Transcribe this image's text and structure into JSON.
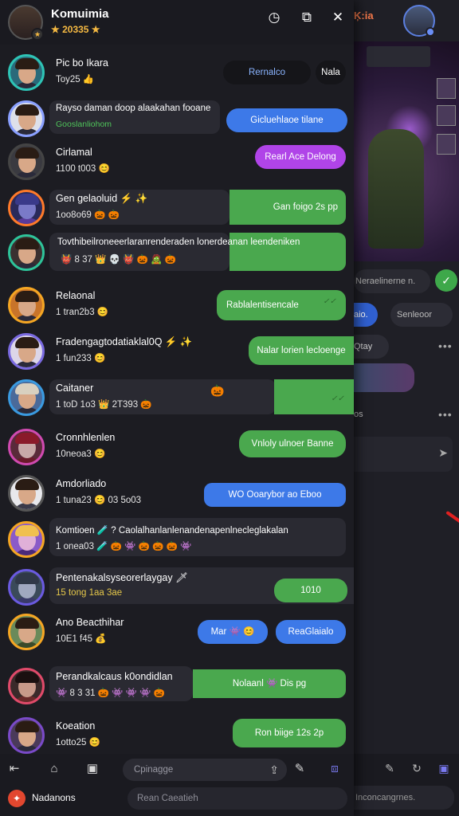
{
  "background": {
    "title": "Ķ:ia",
    "input_placeholder": "Neraelinerne n.",
    "chip_active": "aio.",
    "chip_secondary": "Senleoor",
    "chip_third": "Qtay",
    "chip_fourth": "os",
    "bottom_search": "Inconcangrnes."
  },
  "header": {
    "title": "Komuimia",
    "subtitle": "★ 20335 ★"
  },
  "rows": [
    {
      "name": "Pic bo Ikara",
      "status": "Toy25 👍",
      "bubbles": [
        "Rernalco",
        "Nala"
      ]
    },
    {
      "name": "Rayso daman doop alaakahan fooane",
      "status": "Gooslanliohom",
      "bubbles": [
        "Gicluehlaoe tilane"
      ]
    },
    {
      "name": "Cirlamal",
      "status": "1100 t003 😊",
      "bubbles": [
        "Rearl Ace Delong"
      ]
    },
    {
      "name": "Gen gelaoluid ⚡ ✨",
      "status": "1oo8o69 🎃 🎃",
      "bubbles": [
        "Gan foigo 2s pp"
      ]
    },
    {
      "name": "Tovthibeilroneeerlaranrenderaden lonerdeanan leendeniken",
      "status": "👹 8 37 👑 💀 👹 🎃 🧟 🎃",
      "bubbles": []
    },
    {
      "name": "Relaonal",
      "status": "1 tran2b3 😊",
      "bubbles": [
        "Rablalentisencale"
      ]
    },
    {
      "name": "Fradengagtodatiaklal0Q ⚡ ✨",
      "status": "1 fun233 😊",
      "bubbles": [
        "Nalar lorien lecloenge"
      ]
    },
    {
      "name": "Caitaner",
      "status": "1 toD 1o3 👑 2T393 🎃",
      "bubbles": []
    },
    {
      "name": "Cronnhlenlen",
      "status": "10neoa3 😊",
      "bubbles": [
        "Vnloly ulnoer Banne"
      ]
    },
    {
      "name": "Amdorliado",
      "status": "1 tuna23 😊 03 5o03",
      "bubbles": [
        "WO Ooarybor ao Eboo"
      ]
    },
    {
      "name": "Komtioen 🧪 ? Caolalhanlanlenandenapenlnecleglakalan",
      "status": "1 onea03 🧪 🎃 👾 🎃 🎃 🎃 👾",
      "bubbles": []
    },
    {
      "name": "Pentenakalsyseorerlaygay 🗡",
      "status": "15 tong 1aa 3ae",
      "bubbles": [
        "1010"
      ]
    },
    {
      "name": "Ano Beacthihar",
      "status": "10E1 f45 💰",
      "bubbles": [
        "Mar 👾 😊",
        "ReaGlaialo"
      ]
    },
    {
      "name": "Perandkalcaus k0ondidlan",
      "status": "👾 8 3 31 🎃 👾 👾 👾 🎃",
      "bubbles": [
        "Nolaanl 👾 Dis pg"
      ]
    },
    {
      "name": "Koeation",
      "status": "1otto25 😊",
      "bubbles": [
        "Ron biige 12s 2p"
      ]
    }
  ],
  "bottombar": {
    "field_placeholder": "Cpinagge"
  },
  "footer": {
    "label": "Nadanons",
    "field_placeholder": "Rean Caeatieh"
  }
}
